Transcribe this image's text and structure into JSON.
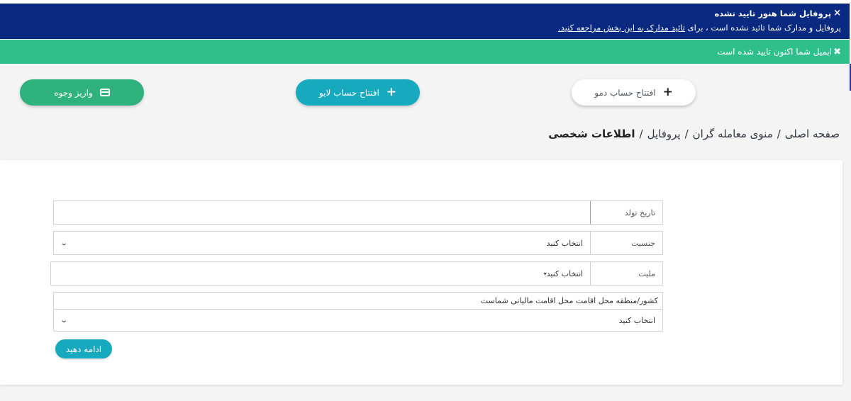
{
  "colors": {
    "alert_blue": "#0a2a82",
    "alert_green": "#2fbf8c",
    "deposit_button": "#30b27e",
    "live_button": "#17a9bd",
    "continue_button": "#17a9bd"
  },
  "alerts": {
    "profile": {
      "title": "پروفایل شما هنوز تایید نشده",
      "message": "پروفایل و مدارک شما تائید نشده است ، برای",
      "link": "تائید مدارک به این بخش مراجعه کنید.",
      "close_icon": "close-icon"
    },
    "email": {
      "message": "ایمیل شما اکنون تایید شده است",
      "close_icon": "close-icon"
    }
  },
  "actions": {
    "deposit": {
      "label": "واریز وجوه",
      "icon": "credit-card-icon"
    },
    "live_account": {
      "label": "افتتاح حساب لایو",
      "icon": "plus-icon"
    },
    "demo_account": {
      "label": "افتتاح حساب دمو",
      "icon": "plus-icon"
    }
  },
  "breadcrumb": {
    "items": [
      "صفحه اصلی",
      "منوی معامله گران",
      "پروفایل"
    ],
    "current": "اطلاعات شخصی",
    "separator": "/"
  },
  "form": {
    "birth_date": {
      "label": "تاریخ تولد",
      "value": ""
    },
    "gender": {
      "label": "جنسیت",
      "selected": "انتخاب کنید"
    },
    "nationality": {
      "label": "ملیت",
      "selected": "انتخاب کنید"
    },
    "country": {
      "label": "کشور/منطقه محل اقامت محل اقامت مالیاتی شماست",
      "selected": "انتخاب کنید"
    },
    "submit_label": "ادامه دهید"
  }
}
